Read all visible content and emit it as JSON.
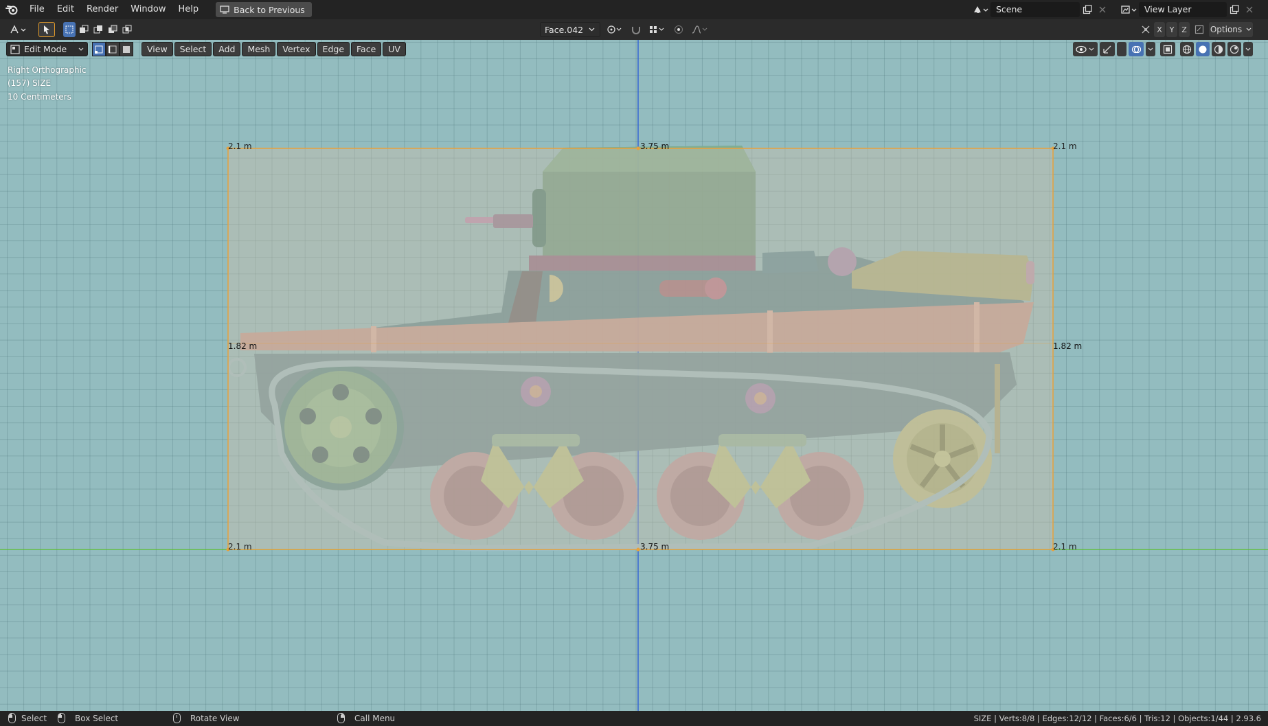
{
  "topbar": {
    "menu": [
      "File",
      "Edit",
      "Render",
      "Window",
      "Help"
    ],
    "back_button": "Back to Previous",
    "scene": "Scene",
    "view_layer": "View Layer"
  },
  "tool_header": {
    "active_object": "Face.042",
    "axes": [
      "X",
      "Y",
      "Z"
    ],
    "options": "Options"
  },
  "viewport_header": {
    "mode": "Edit Mode",
    "menus": [
      "View",
      "Select",
      "Add",
      "Mesh",
      "Vertex",
      "Edge",
      "Face",
      "UV"
    ]
  },
  "viewport_info": {
    "view_name": "Right Orthographic",
    "object": "(157) SIZE",
    "grid_scale": "10 Centimeters"
  },
  "dimensions": {
    "top_left": "2.1 m",
    "top_center": "3.75 m",
    "top_right": "2.1 m",
    "mid_left": "1.82 m",
    "mid_right": "1.82 m",
    "bottom_left": "2.1 m",
    "bottom_center": "3.75 m",
    "bottom_right": "2.1 m"
  },
  "status_bar": {
    "select": "Select",
    "box_select": "Box Select",
    "rotate_view": "Rotate View",
    "call_menu": "Call Menu",
    "stats": "SIZE | Verts:8/8 | Edges:12/12 | Faces:6/6 | Tris:12 | Objects:1/44 | 2.93.6"
  },
  "colors": {
    "viewport_bg": "#93bcbf",
    "bbox_line": "#e7a13c",
    "y_axis": "#2d5fd4",
    "x_axis": "#5bbf2f",
    "active_button": "#4772b3"
  }
}
